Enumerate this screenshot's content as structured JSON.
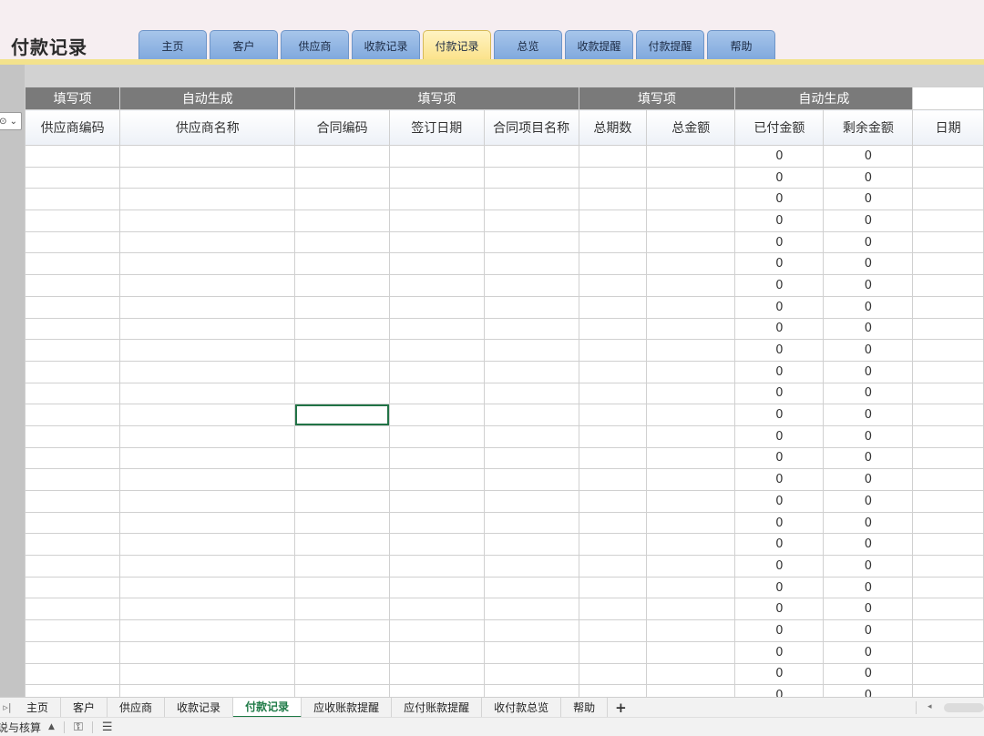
{
  "header": {
    "title": "付款记录",
    "nav_tabs": [
      {
        "label": "主页"
      },
      {
        "label": "客户"
      },
      {
        "label": "供应商"
      },
      {
        "label": "收款记录"
      },
      {
        "label": "付款记录",
        "active": true
      },
      {
        "label": "总览"
      },
      {
        "label": "收款提醒"
      },
      {
        "label": "付款提醒"
      },
      {
        "label": "帮助"
      }
    ]
  },
  "sheet": {
    "filter_icon": "filter-dropdown-icon",
    "group_headers": [
      {
        "label": "填写项",
        "span": 1
      },
      {
        "label": "自动生成",
        "span": 1
      },
      {
        "label": "填写项",
        "span": 3
      },
      {
        "label": "填写项",
        "span": 2
      },
      {
        "label": "自动生成",
        "span": 2
      },
      {
        "label": "",
        "span": 1
      }
    ],
    "columns": [
      "供应商编码",
      "供应商名称",
      "合同编码",
      "签订日期",
      "合同项目名称",
      "总期数",
      "总金额",
      "已付金额",
      "剩余金额",
      "日期"
    ],
    "rows": [
      [
        "",
        "",
        "",
        "",
        "",
        "",
        "",
        "0",
        "0",
        ""
      ],
      [
        "",
        "",
        "",
        "",
        "",
        "",
        "",
        "0",
        "0",
        ""
      ],
      [
        "",
        "",
        "",
        "",
        "",
        "",
        "",
        "0",
        "0",
        ""
      ],
      [
        "",
        "",
        "",
        "",
        "",
        "",
        "",
        "0",
        "0",
        ""
      ],
      [
        "",
        "",
        "",
        "",
        "",
        "",
        "",
        "0",
        "0",
        ""
      ],
      [
        "",
        "",
        "",
        "",
        "",
        "",
        "",
        "0",
        "0",
        ""
      ],
      [
        "",
        "",
        "",
        "",
        "",
        "",
        "",
        "0",
        "0",
        ""
      ],
      [
        "",
        "",
        "",
        "",
        "",
        "",
        "",
        "0",
        "0",
        ""
      ],
      [
        "",
        "",
        "",
        "",
        "",
        "",
        "",
        "0",
        "0",
        ""
      ],
      [
        "",
        "",
        "",
        "",
        "",
        "",
        "",
        "0",
        "0",
        ""
      ],
      [
        "",
        "",
        "",
        "",
        "",
        "",
        "",
        "0",
        "0",
        ""
      ],
      [
        "",
        "",
        "",
        "",
        "",
        "",
        "",
        "0",
        "0",
        ""
      ],
      [
        "",
        "",
        "",
        "",
        "",
        "",
        "",
        "0",
        "0",
        ""
      ],
      [
        "",
        "",
        "",
        "",
        "",
        "",
        "",
        "0",
        "0",
        ""
      ],
      [
        "",
        "",
        "",
        "",
        "",
        "",
        "",
        "0",
        "0",
        ""
      ],
      [
        "",
        "",
        "",
        "",
        "",
        "",
        "",
        "0",
        "0",
        ""
      ],
      [
        "",
        "",
        "",
        "",
        "",
        "",
        "",
        "0",
        "0",
        ""
      ],
      [
        "",
        "",
        "",
        "",
        "",
        "",
        "",
        "0",
        "0",
        ""
      ],
      [
        "",
        "",
        "",
        "",
        "",
        "",
        "",
        "0",
        "0",
        ""
      ],
      [
        "",
        "",
        "",
        "",
        "",
        "",
        "",
        "0",
        "0",
        ""
      ],
      [
        "",
        "",
        "",
        "",
        "",
        "",
        "",
        "0",
        "0",
        ""
      ],
      [
        "",
        "",
        "",
        "",
        "",
        "",
        "",
        "0",
        "0",
        ""
      ],
      [
        "",
        "",
        "",
        "",
        "",
        "",
        "",
        "0",
        "0",
        ""
      ],
      [
        "",
        "",
        "",
        "",
        "",
        "",
        "",
        "0",
        "0",
        ""
      ],
      [
        "",
        "",
        "",
        "",
        "",
        "",
        "",
        "0",
        "0",
        ""
      ],
      [
        "",
        "",
        "",
        "",
        "",
        "",
        "",
        "0",
        "0",
        ""
      ],
      [
        "",
        "",
        "",
        "",
        "",
        "",
        "",
        "0",
        "0",
        ""
      ]
    ],
    "selected_cell": {
      "row": 12,
      "col": 2
    }
  },
  "sheet_tabs": {
    "nav_icon": "last-sheet-icon",
    "tabs": [
      {
        "label": "主页"
      },
      {
        "label": "客户"
      },
      {
        "label": "供应商"
      },
      {
        "label": "收款记录"
      },
      {
        "label": "付款记录",
        "active": true
      },
      {
        "label": "应收账款提醒"
      },
      {
        "label": "应付账款提醒"
      },
      {
        "label": "收付款总览"
      },
      {
        "label": "帮助"
      }
    ],
    "add_label": "+"
  },
  "status_bar": {
    "text": "说与核算",
    "icons": [
      "macro-icon",
      "sheet-list-icon"
    ]
  },
  "colors": {
    "group_header_bg": "#7a7a7a",
    "nav_tab_blue": "#8fb3e3",
    "nav_tab_active": "#fbe28a",
    "selection_green": "#217346"
  }
}
